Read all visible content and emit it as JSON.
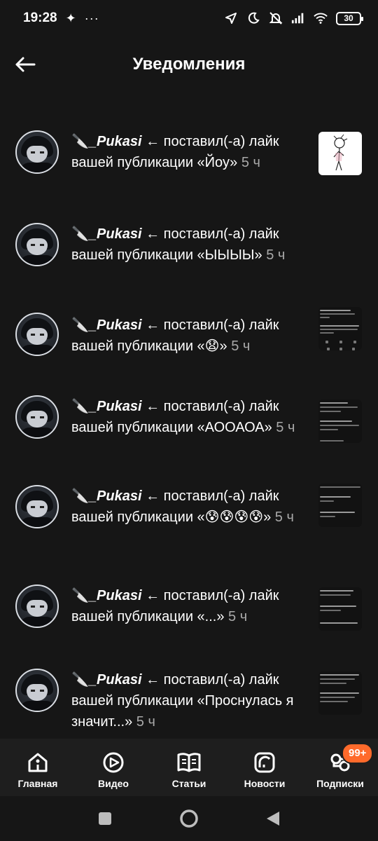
{
  "status_bar": {
    "time": "19:28",
    "battery": "30"
  },
  "header": {
    "title": "Уведомления"
  },
  "notifications": [
    {
      "user": "_Pukasi",
      "knife": "🔪",
      "arrow": "←",
      "action": "поставил(-а) лайк вашей публикации",
      "post": "«Йоу»",
      "time": "5 ч"
    },
    {
      "user": "_Pukasi",
      "knife": "🔪",
      "arrow": "←",
      "action": "поставил(-а) лайк вашей публикации",
      "post": "«ЫЫЫЫ»",
      "time": "5 ч"
    },
    {
      "user": "_Pukasi",
      "knife": "🔪",
      "arrow": "←",
      "action": "поставил(-а) лайк вашей публикации",
      "post": "«😧»",
      "time": "5 ч"
    },
    {
      "user": "_Pukasi",
      "knife": "🔪",
      "arrow": "←",
      "action": "поставил(-а) лайк вашей публикации",
      "post": "«АООАОА»",
      "time": "5 ч"
    },
    {
      "user": "_Pukasi",
      "knife": "🔪",
      "arrow": "←",
      "action": "поставил(-а) лайк вашей публикации",
      "post": "«😰😰😰😰»",
      "time": "5 ч"
    },
    {
      "user": "_Pukasi",
      "knife": "🔪",
      "arrow": "←",
      "action": "поставил(-а) лайк вашей публикации",
      "post": "«...»",
      "time": "5 ч"
    },
    {
      "user": "_Pukasi",
      "knife": "🔪",
      "arrow": "←",
      "action": "поставил(-а) лайк вашей публикации",
      "post": "«Проснулась я значит...»",
      "time": "5 ч"
    }
  ],
  "bottom_nav": {
    "items": [
      {
        "label": "Главная",
        "icon": "home-icon"
      },
      {
        "label": "Видео",
        "icon": "video-icon"
      },
      {
        "label": "Статьи",
        "icon": "articles-icon"
      },
      {
        "label": "Новости",
        "icon": "news-icon"
      },
      {
        "label": "Подписки",
        "icon": "subscriptions-icon"
      }
    ],
    "badge": "99+"
  },
  "colors": {
    "background": "#161616",
    "nav_background": "#1e1e1e",
    "badge": "#ff6a2b",
    "time_text": "#a9a9a9"
  }
}
